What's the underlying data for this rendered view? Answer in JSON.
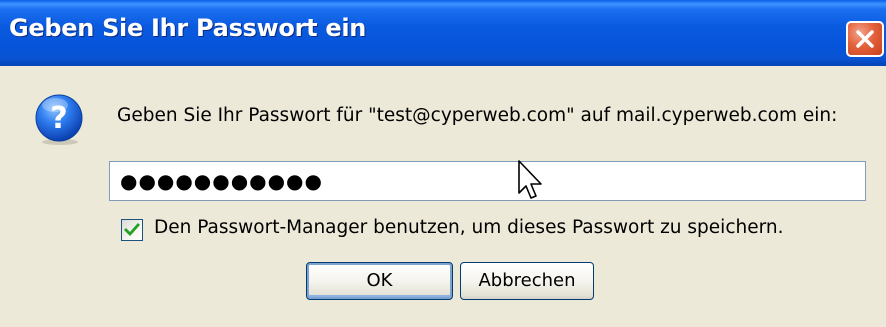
{
  "window": {
    "title": "Geben Sie Ihr Passwort ein"
  },
  "dialog": {
    "icon": "question-icon",
    "prompt": "Geben Sie Ihr Passwort für \"test@cyperweb.com\" auf mail.cyperweb.com ein:",
    "password_value": "●●●●●●●●●●●",
    "remember_label": "Den Passwort-Manager benutzen, um dieses Passwort zu speichern.",
    "remember_checked": true
  },
  "buttons": {
    "ok_label": "OK",
    "cancel_label": "Abbrechen"
  },
  "colors": {
    "titlebar": "#0a54d4",
    "background": "#ece9d8",
    "close_button": "#e3623b"
  }
}
